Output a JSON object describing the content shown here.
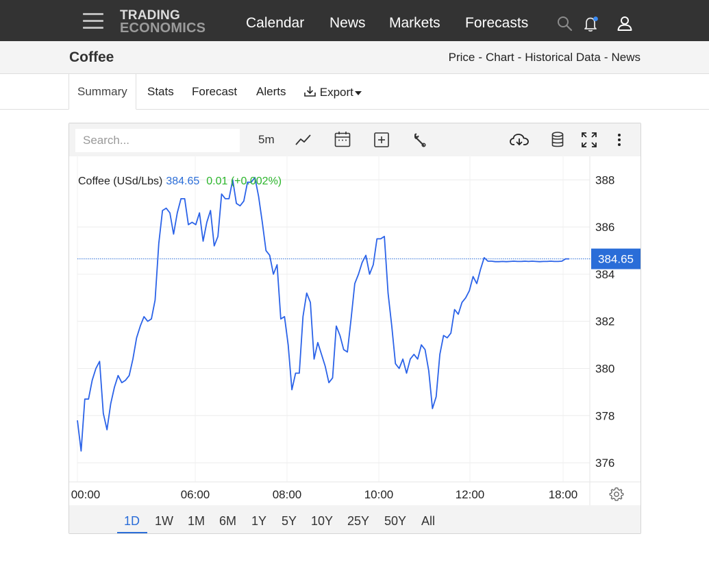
{
  "nav": {
    "logo_line1": "TRADING",
    "logo_line2": "ECONOMICS",
    "links": [
      "Calendar",
      "News",
      "Markets",
      "Forecasts"
    ],
    "icons": [
      "menu-icon",
      "search-icon",
      "bell-icon",
      "user-icon"
    ],
    "notification_dot_color": "#3b8cf5"
  },
  "title_bar": {
    "title": "Coffee",
    "breadcrumb": [
      "Price",
      "Chart",
      "Historical Data",
      "News"
    ],
    "separator": "-"
  },
  "tabs": {
    "items": [
      "Summary",
      "Stats",
      "Forecast",
      "Alerts",
      "Export"
    ],
    "active": "Summary"
  },
  "toolbar": {
    "search_placeholder": "Search...",
    "interval": "5m",
    "icons": [
      "line-chart-icon",
      "calendar-icon",
      "compare-plus-icon",
      "wrench-icon",
      "download-cloud-icon",
      "database-icon",
      "fullscreen-icon",
      "more-vertical-icon"
    ]
  },
  "legend": {
    "name": "Coffee (USd/Lbs)",
    "price": "384.65",
    "change": "0.01 (+0.002%)",
    "price_color": "#2a6dd8",
    "change_color": "#2ab52a"
  },
  "ranges": {
    "items": [
      "1D",
      "1W",
      "1M",
      "6M",
      "1Y",
      "5Y",
      "10Y",
      "25Y",
      "50Y",
      "All"
    ],
    "active": "1D"
  },
  "colors": {
    "line": "#2a62e8",
    "current_price_badge": "#2a6dd8",
    "nav_bg": "#333333"
  },
  "chart_data": {
    "type": "line",
    "title": "Coffee (USd/Lbs)",
    "xlabel": "",
    "ylabel": "",
    "x_tick_labels": [
      "00:00",
      "06:00",
      "08:00",
      "10:00",
      "12:00",
      "18:00"
    ],
    "y_ticks": [
      376,
      378,
      380,
      382,
      384,
      386,
      388
    ],
    "ylim": [
      374.2,
      389
    ],
    "current_price": 384.65,
    "current_price_label": "384.65",
    "grid": true,
    "series": [
      {
        "values": [
          377.8,
          376.5,
          378.7,
          378.7,
          379.5,
          380.0,
          380.3,
          378.1,
          377.4,
          378.5,
          379.2,
          379.7,
          379.4,
          379.5,
          379.7,
          380.4,
          381.3,
          381.8,
          382.2,
          382.0,
          382.1,
          382.9,
          385.3,
          386.7,
          386.8,
          386.6,
          385.7,
          386.6,
          387.2,
          387.2,
          386.1,
          386.2,
          386.1,
          386.6,
          385.4,
          386.2,
          386.7,
          385.2,
          385.6,
          387.4,
          387.2,
          387.2,
          388.0,
          387.0,
          386.9,
          387.1,
          387.9,
          387.9,
          388.1,
          387.3,
          386.2,
          385.0,
          384.8,
          384.0,
          384.4,
          382.1,
          382.2,
          381.0,
          379.1,
          379.8,
          379.8,
          382.2,
          383.2,
          382.8,
          380.4,
          381.1,
          380.6,
          380.1,
          379.4,
          379.6,
          381.8,
          381.4,
          380.8,
          380.7,
          382.1,
          383.6,
          384.0,
          384.5,
          384.8,
          384.0,
          384.4,
          385.5,
          385.5,
          385.6,
          383.2,
          381.8,
          380.2,
          380.0,
          380.4,
          379.8,
          380.4,
          380.6,
          380.4,
          381.0,
          380.8,
          379.9,
          378.3,
          378.8,
          380.6,
          381.4,
          381.3,
          381.5,
          382.5,
          382.3,
          382.8,
          383.0,
          383.3,
          383.9,
          383.6,
          384.2,
          384.7,
          384.55,
          384.55,
          384.53,
          384.53,
          384.54,
          384.53,
          384.54,
          384.55,
          384.54,
          384.54,
          384.55,
          384.54,
          384.55,
          384.54,
          384.53,
          384.54,
          384.54,
          384.55,
          384.54,
          384.54,
          384.55,
          384.65,
          384.65
        ]
      }
    ]
  }
}
